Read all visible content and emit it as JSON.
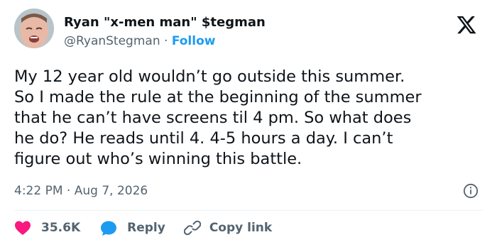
{
  "author": {
    "name": "Ryan \"x-men man\" $tegman",
    "handle": "@RyanStegman",
    "separator": "·",
    "follow_label": "Follow"
  },
  "tweet": {
    "text": "My 12 year old wouldn’t go outside this summer.\nSo I made the rule at the beginning of the summer\nthat he can’t have screens til 4 pm. So what does\nhe do? He reads until 4. 4-5 hours a day. I can’t\nfigure out who’s winning this battle.",
    "time": "4:22 PM",
    "separator": "·",
    "date": "Aug 7, 2026"
  },
  "actions": {
    "like_count": "35.6K",
    "reply_label": "Reply",
    "copy_link_label": "Copy link"
  },
  "colors": {
    "text": "#0f1419",
    "secondary": "#536471",
    "accent": "#1d9bf0",
    "like": "#f91880"
  },
  "icons": [
    "x-logo-icon",
    "info-icon",
    "heart-icon",
    "reply-bubble-icon",
    "link-icon"
  ]
}
